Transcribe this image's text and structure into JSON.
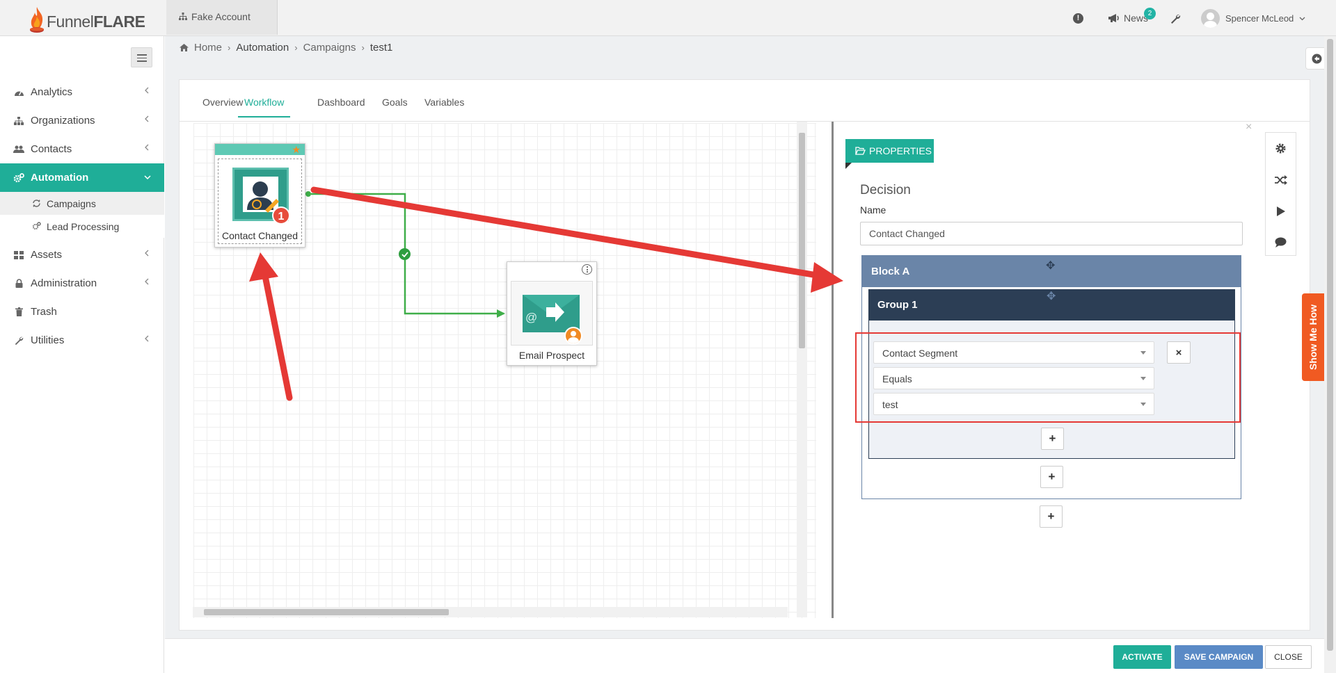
{
  "app": {
    "brand_light": "Funnel",
    "brand_bold": "FLARE",
    "account": "Fake Account"
  },
  "header": {
    "news_label": "News",
    "news_count": "2",
    "user_name": "Spencer McLeod"
  },
  "sidebar": {
    "items": [
      {
        "label": "Analytics",
        "icon": "dashboard-icon"
      },
      {
        "label": "Organizations",
        "icon": "sitemap-icon"
      },
      {
        "label": "Contacts",
        "icon": "users-icon"
      },
      {
        "label": "Automation",
        "icon": "cogs-icon",
        "active": true
      },
      {
        "label": "Assets",
        "icon": "grid-icon"
      },
      {
        "label": "Administration",
        "icon": "lock-icon"
      },
      {
        "label": "Trash",
        "icon": "trash-icon"
      },
      {
        "label": "Utilities",
        "icon": "wrench-icon"
      }
    ],
    "sub_items": [
      {
        "label": "Campaigns",
        "active": true
      },
      {
        "label": "Lead Processing"
      }
    ]
  },
  "breadcrumb": {
    "home": "Home",
    "automation": "Automation",
    "campaigns": "Campaigns",
    "current": "test1"
  },
  "tabs": [
    "Overview",
    "Workflow",
    "Dashboard",
    "Goals",
    "Variables"
  ],
  "active_tab": "Workflow",
  "canvas": {
    "nodes": [
      {
        "label": "Contact Changed",
        "badge": "1"
      },
      {
        "label": "Email Prospect"
      }
    ]
  },
  "properties": {
    "tag": "PROPERTIES",
    "heading": "Decision",
    "name_label": "Name",
    "name_value": "Contact Changed",
    "block_title": "Block A",
    "group_title": "Group 1",
    "condition": {
      "field": "Contact Segment",
      "operator": "Equals",
      "value": "test"
    },
    "remove_symbol": "×",
    "add_symbol": "+"
  },
  "show_me_how": "Show Me How",
  "footer": {
    "activate": "ACTIVATE",
    "save": "SAVE CAMPAIGN",
    "close": "CLOSE"
  },
  "colors": {
    "accent": "#1fae98",
    "block": "#6a85a8",
    "group": "#2c3e55",
    "annotation": "#e53935",
    "show_me": "#f05a22",
    "save": "#5a8ac6"
  }
}
